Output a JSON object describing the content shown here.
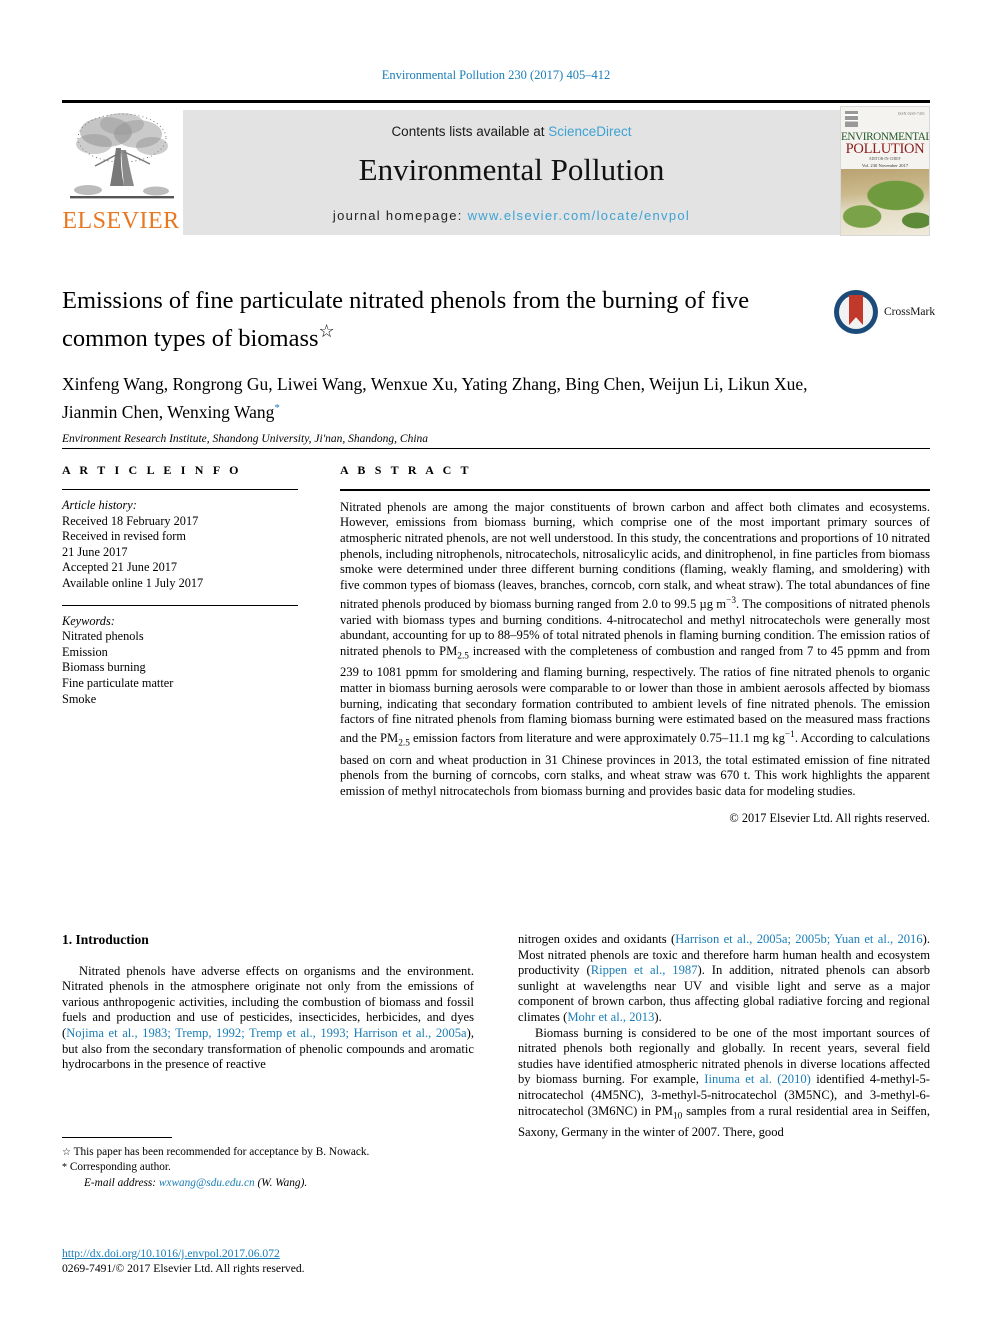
{
  "running_head": "Environmental Pollution 230 (2017) 405–412",
  "masthead": {
    "contents_text": "Contents lists available at ",
    "sciencedirect": "ScienceDirect",
    "journal_title": "Environmental Pollution",
    "homepage_label": "journal homepage: ",
    "homepage_url": "www.elsevier.com/locate/envpol",
    "publisher_logo_text": "ELSEVIER",
    "cover": {
      "line1": "ENVIRONMENTAL",
      "line2": "POLLUTION",
      "issn": "ISSN 0269-7491",
      "sub1": "EDITOR-IN-CHIEF",
      "sub2": "Vol. 230 November 2017"
    },
    "colors": {
      "link": "#3da2d4",
      "elsevier_orange": "#E87722",
      "banner_bg": "#e3e3e3"
    }
  },
  "article": {
    "title": "Emissions of fine particulate nitrated phenols from the burning of five common types of biomass",
    "title_footnote_mark": "☆",
    "authors": "Xinfeng Wang, Rongrong Gu, Liwei Wang, Wenxue Xu, Yating Zhang, Bing Chen, Weijun Li, Likun Xue, Jianmin Chen, Wenxing Wang",
    "corresponding_mark": "*",
    "affiliation": "Environment Research Institute, Shandong University, Ji'nan, Shandong, China",
    "crossmark_label": "CrossMark"
  },
  "article_info": {
    "heading": "A R T I C L E   I N F O",
    "history_label": "Article history:",
    "history": [
      "Received 18 February 2017",
      "Received in revised form",
      "21 June 2017",
      "Accepted 21 June 2017",
      "Available online 1 July 2017"
    ],
    "keywords_label": "Keywords:",
    "keywords": [
      "Nitrated phenols",
      "Emission",
      "Biomass burning",
      "Fine particulate matter",
      "Smoke"
    ]
  },
  "abstract": {
    "heading": "A B S T R A C T",
    "part1": "Nitrated phenols are among the major constituents of brown carbon and affect both climates and ecosystems. However, emissions from biomass burning, which comprise one of the most important primary sources of atmospheric nitrated phenols, are not well understood. In this study, the concentrations and proportions of 10 nitrated phenols, including nitrophenols, nitrocatechols, nitrosalicylic acids, and dinitrophenol, in fine particles from biomass smoke were determined under three different burning conditions (flaming, weakly flaming, and smoldering) with five common types of biomass (leaves, branches, corncob, corn stalk, and wheat straw). The total abundances of fine nitrated phenols produced by biomass burning ranged from 2.0 to 99.5 µg m",
    "sup1": "−3",
    "part2": ". The compositions of nitrated phenols varied with biomass types and burning conditions. 4-nitrocatechol and methyl nitrocatechols were generally most abundant, accounting for up to 88–95% of total nitrated phenols in flaming burning condition. The emission ratios of nitrated phenols to PM",
    "sub1": "2.5",
    "part3": " increased with the completeness of combustion and ranged from 7 to 45 ppmm and from 239 to 1081 ppmm for smoldering and flaming burning, respectively. The ratios of fine nitrated phenols to organic matter in biomass burning aerosols were comparable to or lower than those in ambient aerosols affected by biomass burning, indicating that secondary formation contributed to ambient levels of fine nitrated phenols. The emission factors of fine nitrated phenols from flaming biomass burning were estimated based on the measured mass fractions and the PM",
    "sub2": "2.5",
    "part4": " emission factors from literature and were approximately 0.75–11.1 mg kg",
    "sup2": "−1",
    "part5": ". According to calculations based on corn and wheat production in 31 Chinese provinces in 2013, the total estimated emission of fine nitrated phenols from the burning of corncobs, corn stalks, and wheat straw was 670 t. This work highlights the apparent emission of methyl nitrocatechols from biomass burning and provides basic data for modeling studies.",
    "copyright": "© 2017 Elsevier Ltd. All rights reserved."
  },
  "introduction": {
    "section_title": "1. Introduction",
    "left": {
      "p1_a": "Nitrated phenols have adverse effects on organisms and the environment. Nitrated phenols in the atmosphere originate not only from the emissions of various anthropogenic activities, including the combustion of biomass and fossil fuels and production and use of pesticides, insecticides, herbicides, and dyes (",
      "p1_ref": "Nojima et al., 1983; Tremp, 1992; Tremp et al., 1993; Harrison et al., 2005a",
      "p1_b": "), but also from the secondary transformation of phenolic compounds and aromatic hydrocarbons in the presence of reactive"
    },
    "right": {
      "p1_a": "nitrogen oxides and oxidants (",
      "p1_ref1": "Harrison et al., 2005a; 2005b; Yuan et al., 2016",
      "p1_b": "). Most nitrated phenols are toxic and therefore harm human health and ecosystem productivity (",
      "p1_ref2": "Rippen et al., 1987",
      "p1_c": "). In addition, nitrated phenols can absorb sunlight at wavelengths near UV and visible light and serve as a major component of brown carbon, thus affecting global radiative forcing and regional climates (",
      "p1_ref3": "Mohr et al., 2013",
      "p1_d": ").",
      "p2_a": "Biomass burning is considered to be one of the most important sources of nitrated phenols both regionally and globally. In recent years, several field studies have identified atmospheric nitrated phenols in diverse locations affected by biomass burning. For example, ",
      "p2_ref1": "Iinuma et al. (2010)",
      "p2_b": " identified 4-methyl-5-nitrocatechol (4M5NC), 3-methyl-5-nitrocatechol (3M5NC), and 3-methyl-6-nitrocatechol (3M6NC) in PM",
      "p2_sub": "10",
      "p2_c": " samples from a rural residential area in Seiffen, Saxony, Germany in the winter of 2007. There, good"
    }
  },
  "footnotes": {
    "star_mark": "☆",
    "star_text": "This paper has been recommended for acceptance by B. Nowack.",
    "corr_mark": "*",
    "corr_text": "Corresponding author.",
    "email_label": "E-mail address: ",
    "email": "wxwang@sdu.edu.cn",
    "email_suffix": " (W. Wang)."
  },
  "footer": {
    "doi": "http://dx.doi.org/10.1016/j.envpol.2017.06.072",
    "issn_line": "0269-7491/© 2017 Elsevier Ltd. All rights reserved."
  }
}
